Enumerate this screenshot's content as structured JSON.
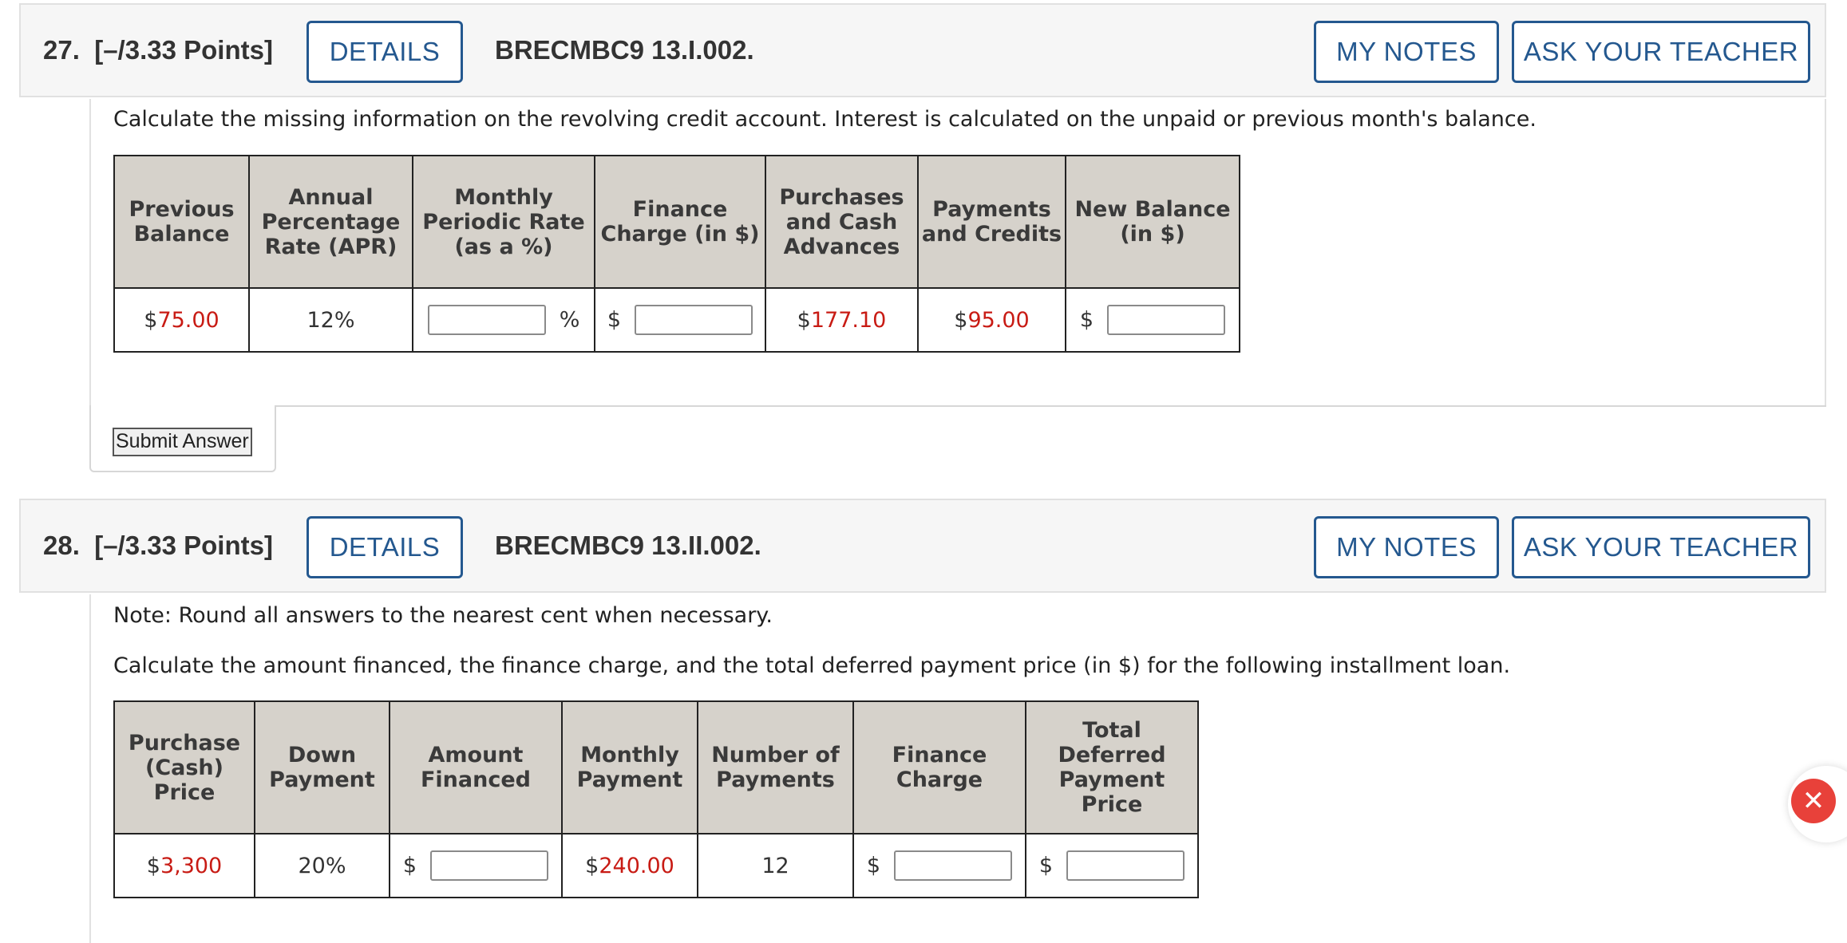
{
  "q27": {
    "number": "27.",
    "points": "[–/3.33 Points]",
    "details_label": "DETAILS",
    "code": "BRECMBC9 13.I.002.",
    "my_notes_label": "MY NOTES",
    "ask_teacher_label": "ASK YOUR TEACHER",
    "instruction": "Calculate the missing information on the revolving credit account. Interest is calculated on the unpaid or previous month's balance.",
    "headers": [
      "Previous Balance",
      "Annual Percentage Rate (APR)",
      "Monthly Periodic Rate (as a %)",
      "Finance Charge (in $)",
      "Purchases and Cash Advances",
      "Payments and Credits",
      "New Balance (in $)"
    ],
    "previous_balance": {
      "prefix": "$",
      "value": "75.00"
    },
    "apr": "12%",
    "rate_unit": "%",
    "finance_charge_prefix": "$",
    "purchases": {
      "prefix": "$",
      "value": "177.10"
    },
    "payments": {
      "prefix": "$",
      "value": "95.00"
    },
    "new_balance_prefix": "$",
    "submit_label": "Submit Answer"
  },
  "q28": {
    "number": "28.",
    "points": "[–/3.33 Points]",
    "details_label": "DETAILS",
    "code": "BRECMBC9 13.II.002.",
    "my_notes_label": "MY NOTES",
    "ask_teacher_label": "ASK YOUR TEACHER",
    "note": "Note: Round all answers to the nearest cent when necessary.",
    "instruction": "Calculate the amount financed, the finance charge, and the total deferred payment price (in $) for the following installment loan.",
    "headers": [
      "Purchase (Cash) Price",
      "Down Payment",
      "Amount Financed",
      "Monthly Payment",
      "Number of Payments",
      "Finance Charge",
      "Total Deferred Payment Price"
    ],
    "purchase_price": {
      "prefix": "$",
      "value": "3,300"
    },
    "down_payment": "20%",
    "amount_financed_prefix": "$",
    "monthly_payment": {
      "prefix": "$",
      "value": "240.00"
    },
    "num_payments": "12",
    "finance_charge_prefix": "$",
    "total_deferred_prefix": "$"
  },
  "close_widget": {
    "icon": "close-icon",
    "glyph": "✕",
    "color": "#e8413a"
  }
}
